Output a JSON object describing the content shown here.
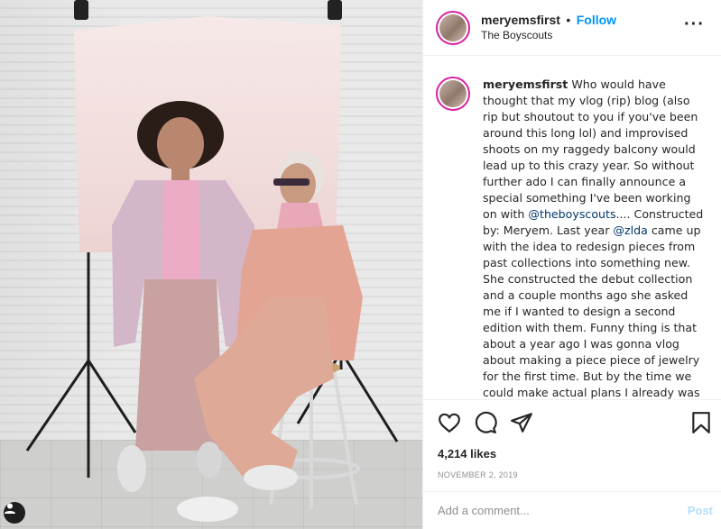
{
  "post": {
    "username": "meryemsfirst",
    "separator": "•",
    "follow_label": "Follow",
    "location": "The Boyscouts",
    "more_icon": "more-options-icon",
    "caption": {
      "username": "meryemsfirst",
      "text_1": " Who would have thought that my vlog (rip) blog (also rip but shoutout to you if you've been around this long lol) and improvised shoots on my raggedy balcony would lead up to this crazy year. So without further ado I can finally announce a special something I've been working on with ",
      "mention_1": "@theboyscouts",
      "text_2": ".... Constructed by: Meryem. Last year ",
      "mention_2": "@zlda",
      "text_3": " came up with the idea to redesign pieces from past collections into something new. She constructed the debut collection and a couple months ago she asked me if I wanted to design a second edition with them. Funny thing is that about a year ago I was gonna vlog about making a piece piece of jewelry for the first time. But by the time we could make actual plans I already was"
    },
    "likes": "4,214 likes",
    "date": "NOVEMBER 2, 2019",
    "comment_placeholder": "Add a comment...",
    "post_label": "Post",
    "icons": {
      "like": "heart-icon",
      "comment": "comment-icon",
      "share": "share-icon",
      "save": "bookmark-icon",
      "user_tag": "user-tag-icon"
    },
    "colors": {
      "accent": "#0095f6",
      "post_disabled": "#b2dffc",
      "mention": "#00376b",
      "muted": "#8e8e8e"
    }
  }
}
